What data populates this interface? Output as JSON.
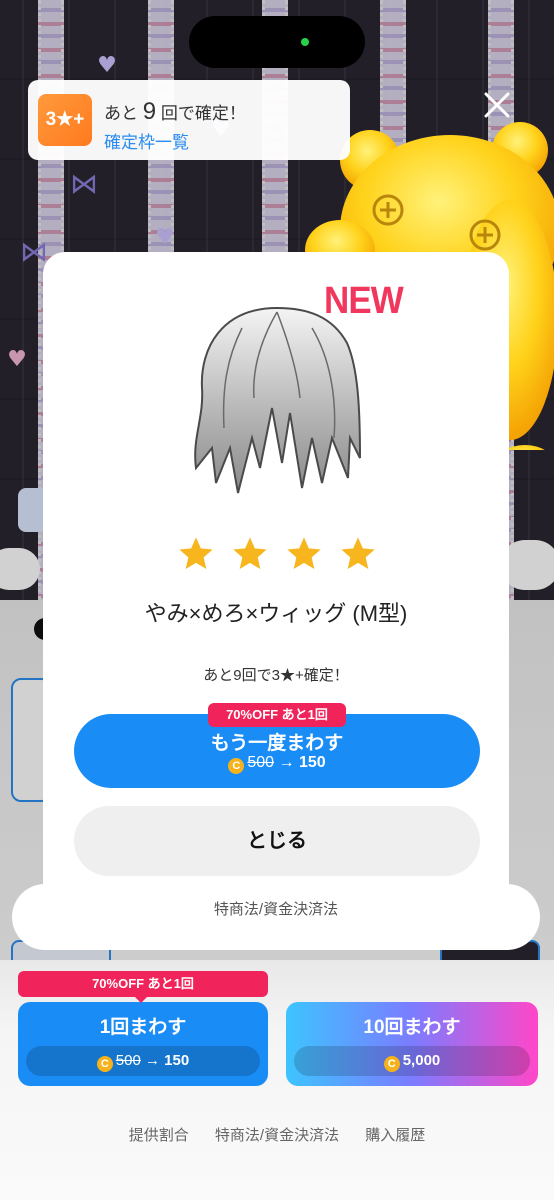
{
  "banner": {
    "badge": "3★+",
    "prefix": "あと",
    "count": "9",
    "suffix": "回で確定！",
    "link": "確定枠一覧"
  },
  "modal": {
    "new_label": "NEW",
    "stars": 4,
    "item_name": "やみ×めろ×ウィッグ (M型)",
    "remain_text": "あと9回で3★+確定！",
    "spin_again": {
      "tag": "70%OFF あと1回",
      "label": "もう一度まわす",
      "old_price": "500",
      "arrow": "→",
      "new_price": "150"
    },
    "close_label": "とじる",
    "legal_link": "特商法/資金決済法"
  },
  "gacha": {
    "single": {
      "tag": "70%OFF あと1回",
      "label": "1回まわす",
      "old_price": "500",
      "arrow": "→",
      "new_price": "150"
    },
    "ten": {
      "label": "10回まわす",
      "price": "5,000"
    }
  },
  "footer": {
    "links": [
      "提供割合",
      "特商法/資金決済法",
      "購入履歴"
    ]
  },
  "colors": {
    "accent_blue": "#1a8cf5",
    "sale_red": "#f0245a",
    "new_pink": "#f0385e",
    "star_gold": "#f7b51e",
    "coin_gold": "#f5b21a"
  },
  "icons": {
    "close": "close-icon",
    "coin": "coin-icon",
    "star": "star-icon"
  }
}
